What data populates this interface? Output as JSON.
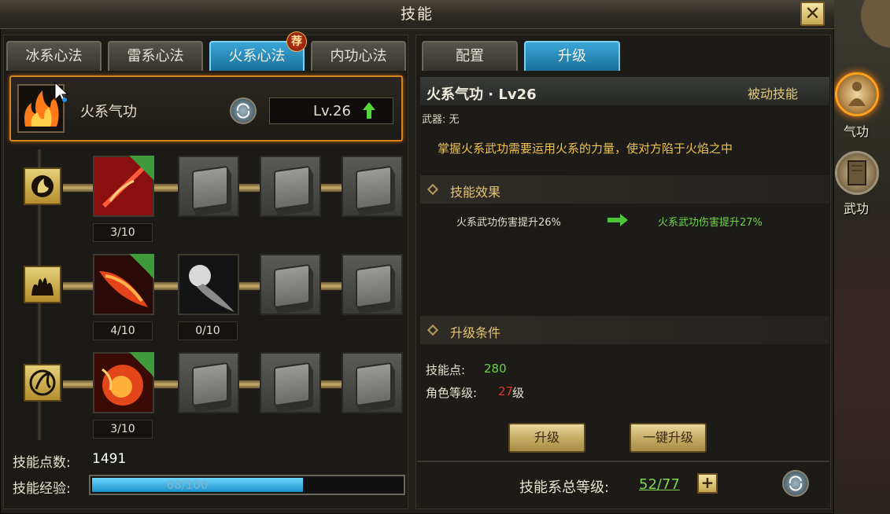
{
  "window": {
    "title": "技能",
    "close_symbol": "✕"
  },
  "tabs": [
    {
      "label": "冰系心法",
      "active": false
    },
    {
      "label": "雷系心法",
      "active": false
    },
    {
      "label": "火系心法",
      "active": true
    },
    {
      "label": "内功心法",
      "active": false
    }
  ],
  "recommend_badge": "荐",
  "skill_header": {
    "name": "火系气功",
    "level": "Lv.26"
  },
  "skill_tree": {
    "rows": [
      {
        "icon": "fire-swirl-icon",
        "slots": [
          {
            "icon": "sword-slash-icon",
            "level": "3/10",
            "equipped": true
          },
          {
            "icon": "locked-book-icon",
            "level": null
          },
          {
            "icon": "locked-book-icon",
            "level": null
          },
          {
            "icon": "locked-book-icon",
            "level": null
          }
        ]
      },
      {
        "icon": "flame-burst-icon",
        "slots": [
          {
            "icon": "fire-strike-icon",
            "level": "4/10",
            "equipped": true
          },
          {
            "icon": "comet-icon",
            "level": "0/10"
          },
          {
            "icon": "locked-book-icon",
            "level": null
          },
          {
            "icon": "locked-book-icon",
            "level": null
          }
        ]
      },
      {
        "icon": "flame-shield-icon",
        "slots": [
          {
            "icon": "inferno-icon",
            "level": "3/10",
            "equipped": true
          },
          {
            "icon": "locked-book-icon",
            "level": null
          },
          {
            "icon": "locked-book-icon",
            "level": null
          },
          {
            "icon": "locked-book-icon",
            "level": null
          }
        ]
      }
    ]
  },
  "stats": {
    "points_label": "技能点数:",
    "points_value": "1491",
    "exp_label": "技能经验:",
    "exp_text": "68/100",
    "exp_fraction": 0.68
  },
  "right_tabs": [
    {
      "label": "配置",
      "active": false
    },
    {
      "label": "升级",
      "active": true
    }
  ],
  "detail": {
    "title": "火系气功 · Lv26",
    "type": "被动技能",
    "weapon": "武器: 无",
    "description": "掌握火系武功需要运用火系的力量，使对方陷于火焰之中",
    "effect_section": "技能效果",
    "effect_current": "火系武功伤害提升26%",
    "effect_next": "火系武功伤害提升27%",
    "condition_section": "升级条件",
    "cond_points_label": "技能点:",
    "cond_points_value": "280",
    "cond_level_label": "角色等级:",
    "cond_level_value": "27",
    "cond_level_suffix": "级",
    "upgrade_button": "升级",
    "one_click_button": "一键升级"
  },
  "footer": {
    "total_label": "技能系总等级:",
    "total_value": "52/77",
    "plus_symbol": "+"
  },
  "side_buttons": [
    {
      "label": "气功",
      "icon": "meditation-icon",
      "active": true
    },
    {
      "label": "武功",
      "icon": "book-icon",
      "active": false
    }
  ],
  "colors": {
    "accent_orange": "#d7831c",
    "active_tab": "#3aa6d8",
    "green_value": "#6fd04a",
    "red_value": "#e0362a",
    "gold_text": "#efc24f"
  }
}
